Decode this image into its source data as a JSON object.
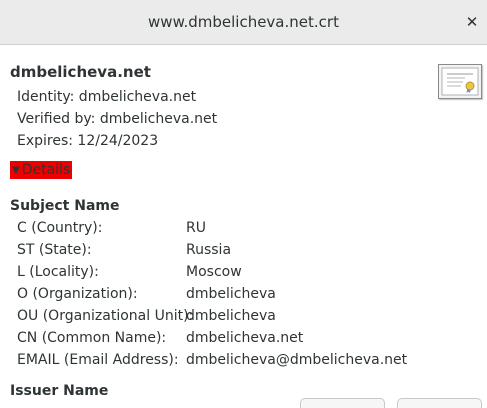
{
  "window": {
    "title": "www.dmbelicheva.net.crt",
    "close_glyph": "✕"
  },
  "certificate": {
    "name": "dmbelicheva.net",
    "identity": "Identity: dmbelicheva.net",
    "verified_by": "Verified by: dmbelicheva.net",
    "expires": "Expires: 12/24/2023",
    "icon": "certificate-icon"
  },
  "details": {
    "label": "Details",
    "expanded": true,
    "highlight_color": "#ee0000"
  },
  "subject": {
    "title": "Subject Name",
    "fields": [
      {
        "key": "C (Country):",
        "value": "RU"
      },
      {
        "key": "ST (State):",
        "value": "Russia"
      },
      {
        "key": "L (Locality):",
        "value": "Moscow"
      },
      {
        "key": "O (Organization):",
        "value": "dmbelicheva"
      },
      {
        "key": "OU (Organizational Unit):",
        "value": "dmbelicheva"
      },
      {
        "key": "CN (Common Name):",
        "value": "dmbelicheva.net"
      },
      {
        "key": "EMAIL (Email Address):",
        "value": "dmbelicheva@dmbelicheva.net"
      }
    ]
  },
  "issuer": {
    "title": "Issuer Name"
  }
}
